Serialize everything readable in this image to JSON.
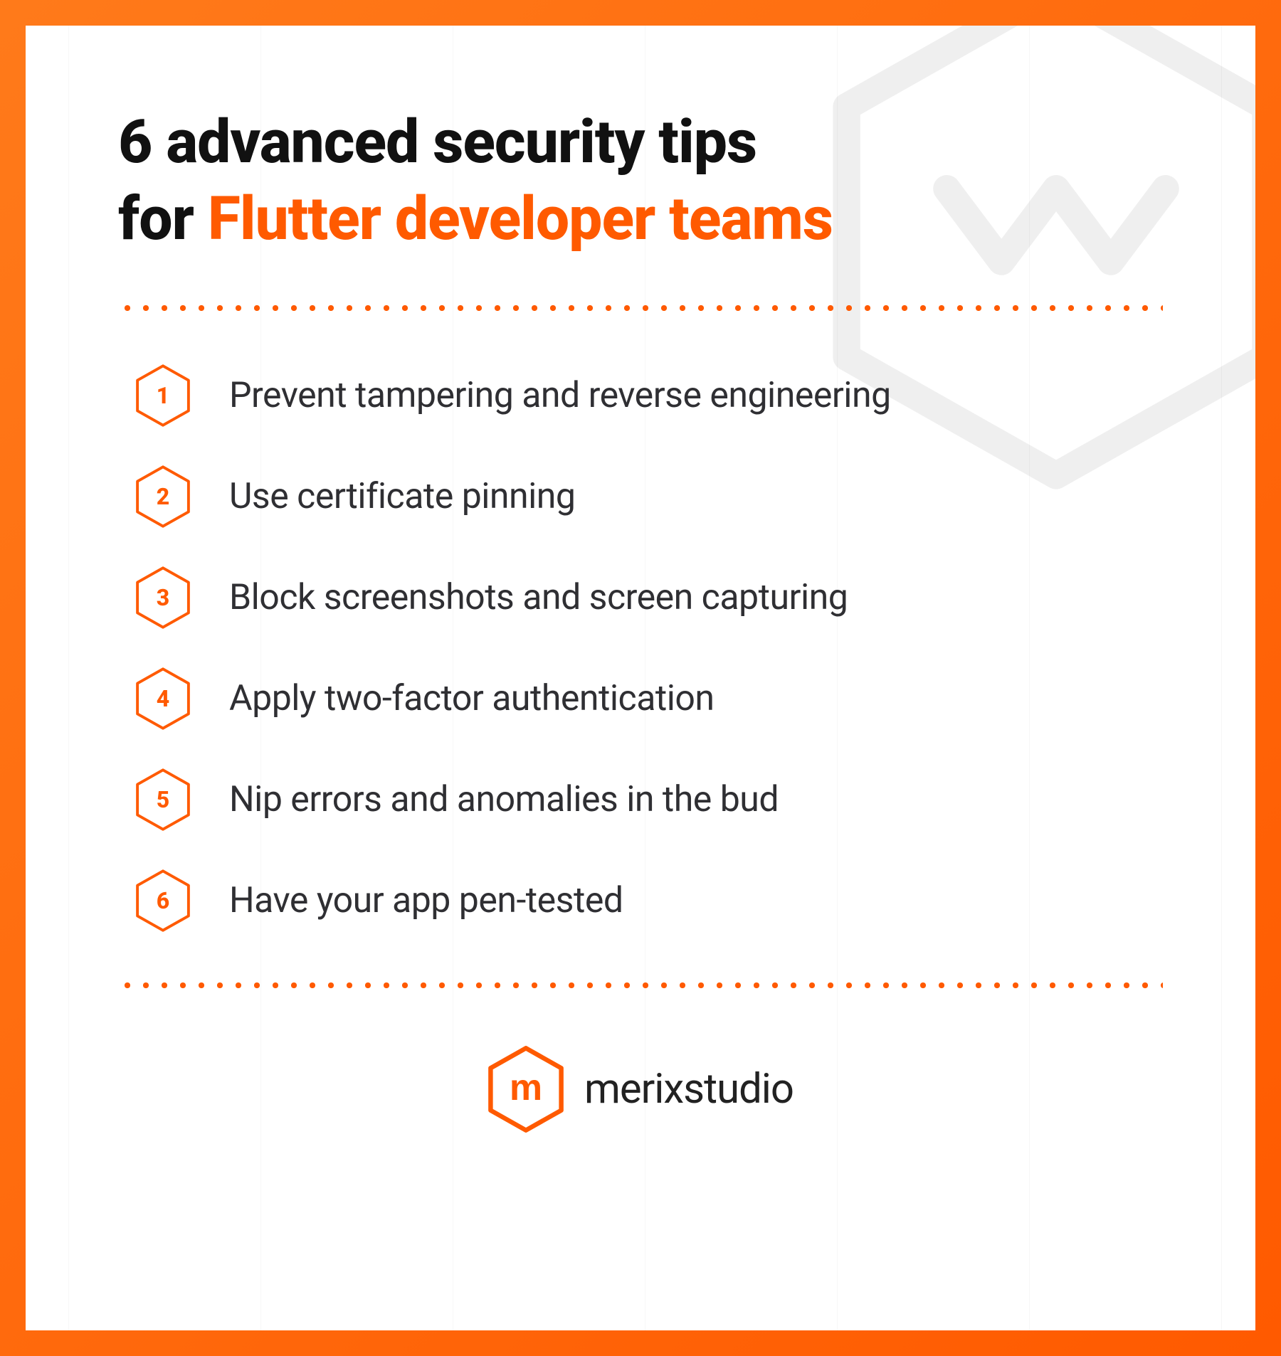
{
  "title": {
    "line1": "6 advanced security tips",
    "line2_prefix": "for ",
    "line2_accent": "Flutter developer teams"
  },
  "tips": [
    {
      "num": "1",
      "text": "Prevent tampering and reverse engineering"
    },
    {
      "num": "2",
      "text": "Use certificate pinning"
    },
    {
      "num": "3",
      "text": "Block screenshots and screen capturing"
    },
    {
      "num": "4",
      "text": "Apply two-factor authentication"
    },
    {
      "num": "5",
      "text": "Nip errors and anomalies in the bud"
    },
    {
      "num": "6",
      "text": "Have your app pen-tested"
    }
  ],
  "brand": {
    "glyph": "m",
    "name": "merixstudio"
  },
  "colors": {
    "accent": "#ff5a00",
    "text": "#2f2f33"
  }
}
